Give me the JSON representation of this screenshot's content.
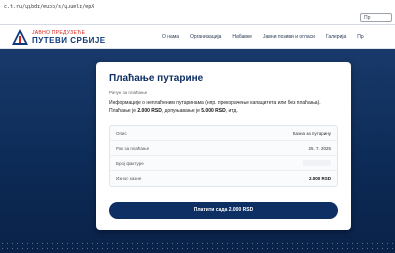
{
  "browser": {
    "url": "c.t.ru/ɥʇbdɪ/ɐuɔɔ/s/ɥɹuɐlɪ/ɐpʎ",
    "search_label": "Пр"
  },
  "header": {
    "logo_small": "ЈАВНО ПРЕДУЗЕЋЕ",
    "logo_big": "ПУТЕВИ СРБИЈЕ",
    "nav": [
      "О нама",
      "Организација",
      "Набавке",
      "Јавни позиви и огласи",
      "Галерија",
      "Пр"
    ]
  },
  "card": {
    "title": "Плаћање путарине",
    "subtitle": "Рачун за плаћање",
    "description_part1": "Информације о неплаћеним путаринама (нпр. прекорачење капацитета или без плаћања). Плаћање је ",
    "description_amount1": "2.000 RSD",
    "description_part2": ", допуњавање је ",
    "description_amount2": "5.000 RSD",
    "description_part3": ", итд.",
    "details": [
      {
        "label": "Опис",
        "value": "Казна за путарину"
      },
      {
        "label": "Рок за плаћање",
        "value": "25. 7. 2025"
      },
      {
        "label": "Број фактуре",
        "value": ""
      },
      {
        "label": "Износ казне",
        "value": "2.000 RSD"
      }
    ],
    "pay_button": "Платити сада 2.000 RSD"
  },
  "colors": {
    "brand_navy": "#0e2f63",
    "brand_red": "#d4231c",
    "background": "#0f2e5a"
  }
}
